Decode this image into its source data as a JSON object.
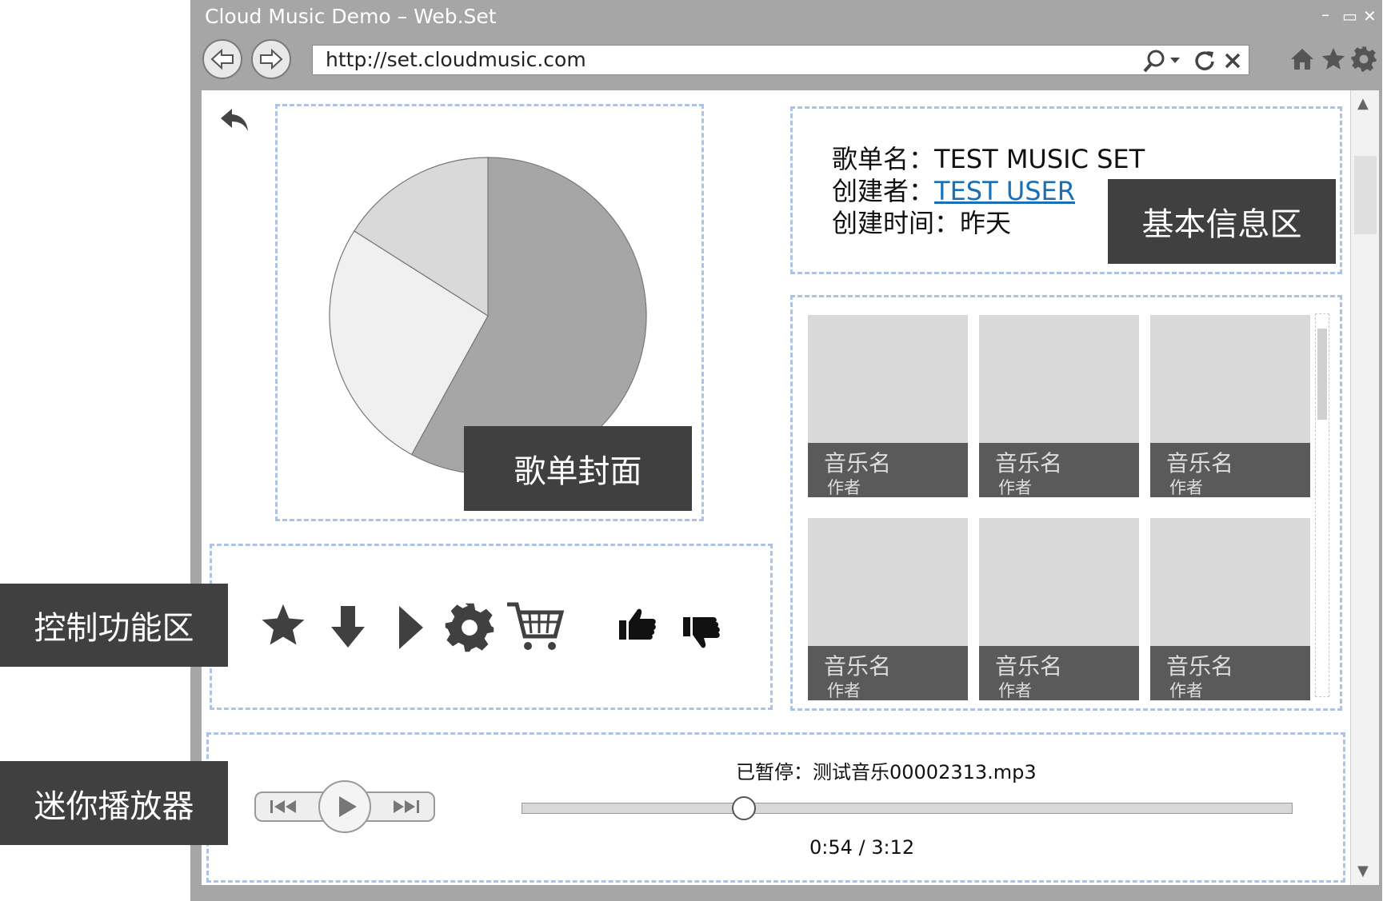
{
  "window": {
    "title": "Cloud Music Demo – Web.Set",
    "controls": {
      "minimize": "–",
      "maximize": "▭",
      "close": "✕"
    }
  },
  "browser": {
    "url": "http://set.cloudmusic.com",
    "icons": [
      "back-arrow-icon",
      "forward-arrow-icon",
      "search-icon",
      "refresh-icon",
      "stop-icon",
      "home-icon",
      "favorite-star-icon",
      "settings-gear-icon"
    ]
  },
  "annotations": {
    "cover": "歌单封面",
    "info": "基本信息区",
    "controls": "控制功能区",
    "player": "迷你播放器"
  },
  "playlist": {
    "name_label": "歌单名：",
    "name_value": "TEST MUSIC SET",
    "creator_label": "创建者：",
    "creator_value": "TEST USER",
    "created_label": "创建时间：",
    "created_value": "昨天",
    "cover_slices": [
      0.58,
      0.26,
      0.16
    ]
  },
  "songs": [
    {
      "name": "音乐名",
      "author": "作者"
    },
    {
      "name": "音乐名",
      "author": "作者"
    },
    {
      "name": "音乐名",
      "author": "作者"
    },
    {
      "name": "音乐名",
      "author": "作者"
    },
    {
      "name": "音乐名",
      "author": "作者"
    },
    {
      "name": "音乐名",
      "author": "作者"
    }
  ],
  "control_icons": [
    "star-icon",
    "download-icon",
    "play-icon",
    "settings-gear-icon",
    "cart-icon",
    "thumbs-up-icon",
    "thumbs-down-icon"
  ],
  "player": {
    "status": "已暂停：测试音乐00002313.mp3",
    "time": "0:54 / 3:12",
    "progress": 0.2885
  },
  "colors": {
    "chrome": "#a6a6a6",
    "annotation_bg": "#404040",
    "dashed_border": "#adc2e4",
    "tile_bg": "#d9d9d9",
    "tile_footer": "#5a5a5a",
    "link": "#1a6fb5"
  }
}
